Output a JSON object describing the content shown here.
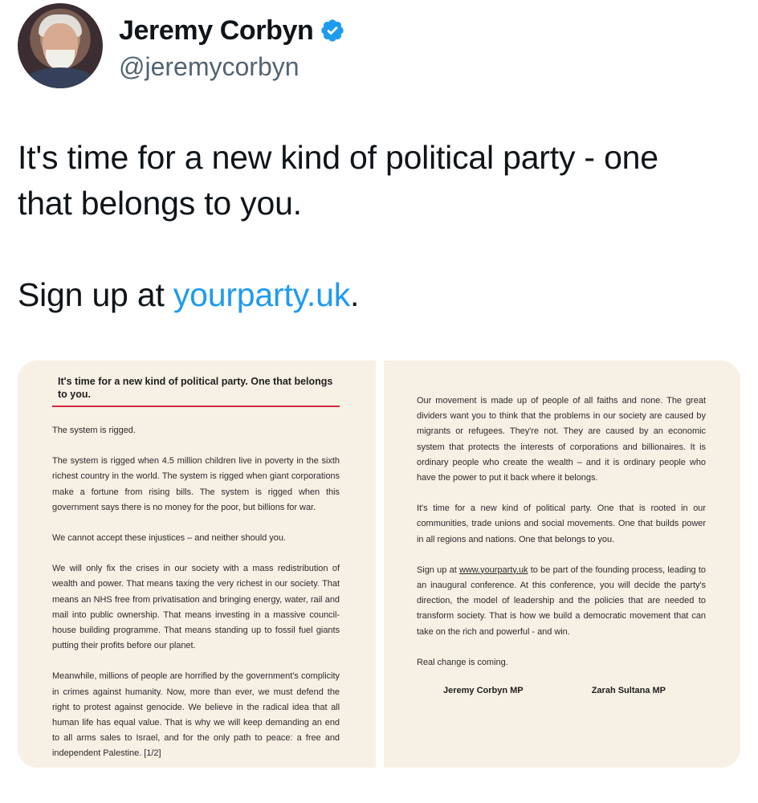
{
  "author": {
    "display_name": "Jeremy Corbyn",
    "handle": "@jeremycorbyn",
    "verified_icon": "verified-check-icon",
    "verified_color": "#1d9bf0"
  },
  "tweet": {
    "line1": "It's time for a new kind of political party - one",
    "line2": "that belongs to you.",
    "signup_prefix": "Sign up at ",
    "signup_link": "yourparty.uk",
    "signup_suffix": "."
  },
  "letter": {
    "left": {
      "title": "It's time for a new kind of political party. One that belongs to you.",
      "paragraphs": [
        "The system is rigged.",
        "The system is rigged when 4.5 million children live in poverty in the sixth richest country in the world. The system is rigged when giant corporations make a fortune from rising bills. The system is rigged when this government says there is no money for the poor, but billions for war.",
        "We cannot accept these injustices – and neither should you.",
        "We will only fix the crises in our society with a mass redistribution of wealth and power. That means taxing the very richest in our society. That means an NHS free from privatisation and bringing energy, water, rail and mail into public ownership. That means investing in a massive council-house building programme. That means standing up to fossil fuel giants putting their profits before our planet.",
        "Meanwhile, millions of people are horrified by the government's complicity in crimes against humanity. Now, more than ever, we must defend the right to protest against genocide. We believe in the radical idea that all human life has equal value. That is why we will keep demanding an end to all arms sales to Israel, and for the only path to peace: a free and independent Palestine. [1/2]"
      ]
    },
    "right": {
      "paragraphs": [
        "Our movement is made up of people of all faiths and none. The great dividers want you to think that the problems in our society are caused by migrants or refugees. They're not. They are caused by an economic system that protects the interests of corporations and billionaires. It is ordinary people who create the wealth – and it is ordinary people who have the power to put it back where it belongs.",
        "It's time for a new kind of political party. One that is rooted in our communities, trade unions and social movements. One that builds power in all regions and nations. One that belongs to you."
      ],
      "signup_prefix": "Sign up at ",
      "signup_link": "www.yourparty.uk",
      "signup_rest": " to be part of the founding process, leading to an inaugural conference. At this conference, you will decide the party's direction, the model of leadership and the policies that are needed to transform society. That is how we build a democratic movement that can take on the rich and powerful - and win.",
      "closing": "Real change is coming.",
      "signature_1": "Jeremy Corbyn MP",
      "signature_2": "Zarah Sultana MP"
    }
  },
  "colors": {
    "link": "#1d9bf0",
    "page_background": "#f7f0e4",
    "title_rule": "#d2283f"
  }
}
